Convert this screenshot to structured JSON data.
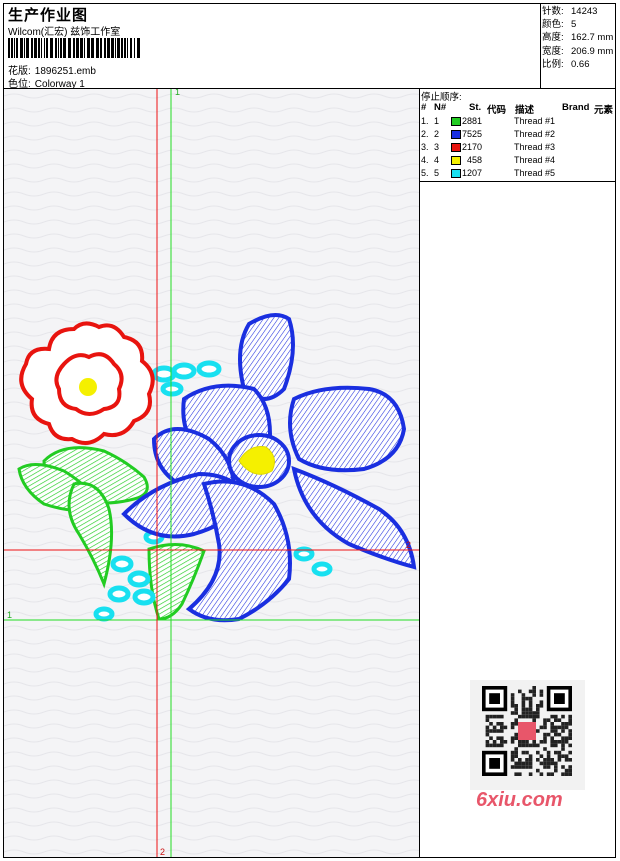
{
  "header": {
    "title": "生产作业图",
    "studio": "Wilcom(汇宏) 兹饰工作室",
    "design_label": "花版:",
    "design_file": "1896251.emb",
    "colorway_label": "色位:",
    "colorway": "Colorway 1"
  },
  "stats": [
    {
      "label": "针数:",
      "value": "14243"
    },
    {
      "label": "颜色:",
      "value": "5"
    },
    {
      "label": "高度:",
      "value": "162.7 mm"
    },
    {
      "label": "宽度:",
      "value": "206.9 mm"
    },
    {
      "label": "比例:",
      "value": "0.66"
    }
  ],
  "sequence": {
    "title": "停止顺序:",
    "headers": {
      "hash": "#",
      "n": "N#",
      "st": "St.",
      "code": "代码",
      "desc": "描述",
      "brand": "Brand",
      "element": "元素"
    },
    "rows": [
      {
        "num": "1.",
        "n": "1",
        "color": "#22cc22",
        "st": "2881",
        "desc": "Thread #1"
      },
      {
        "num": "2.",
        "n": "2",
        "color": "#1a2fe0",
        "st": "7525",
        "desc": "Thread #2"
      },
      {
        "num": "3.",
        "n": "3",
        "color": "#e8140f",
        "st": "2170",
        "desc": "Thread #3"
      },
      {
        "num": "4.",
        "n": "4",
        "color": "#f5f000",
        "st": "458",
        "desc": "Thread #4"
      },
      {
        "num": "5.",
        "n": "5",
        "color": "#18e0f0",
        "st": "1207",
        "desc": "Thread #5"
      }
    ]
  },
  "guides": {
    "label_1": "1",
    "label_2": "2"
  },
  "watermark": {
    "text": "6xiu.com",
    "color": "#e8566a"
  }
}
